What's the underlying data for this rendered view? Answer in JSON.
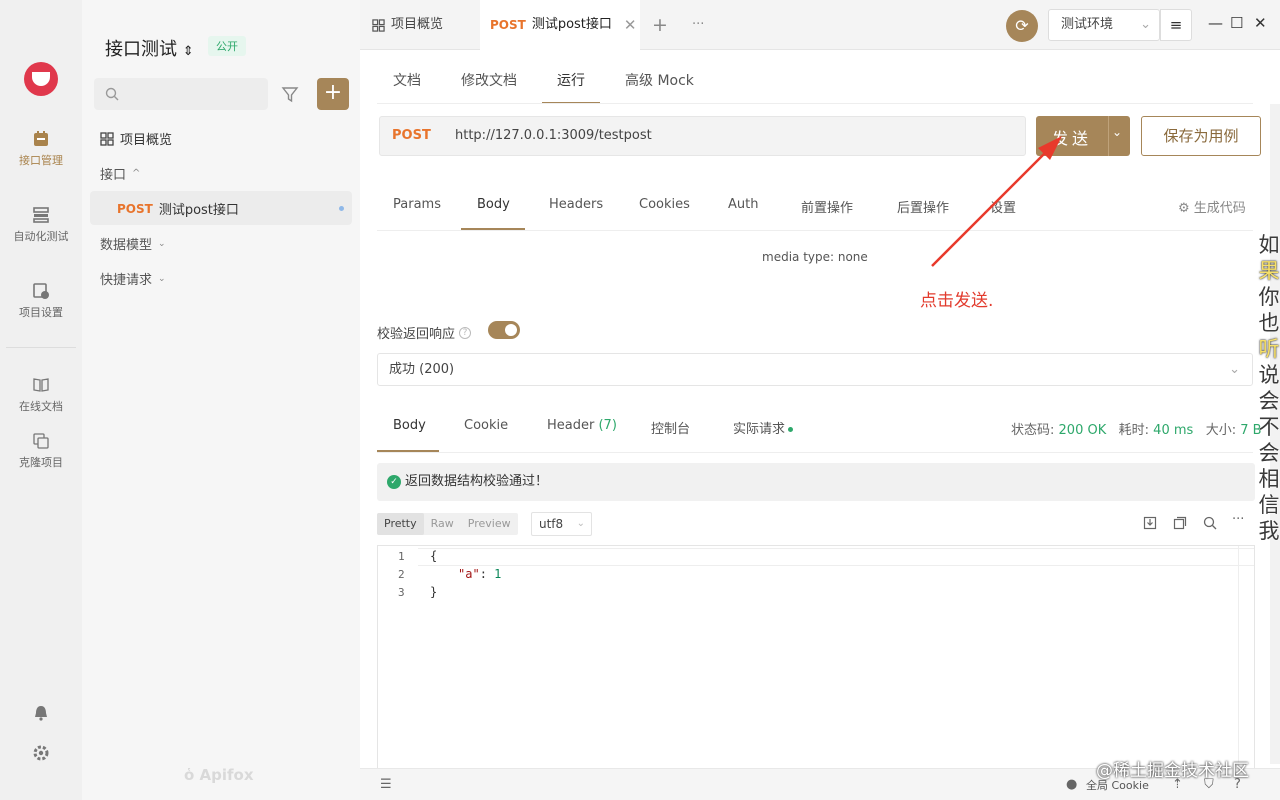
{
  "rail": {
    "items": [
      {
        "label": "接口管理",
        "icon": "api-manage-icon"
      },
      {
        "label": "自动化测试",
        "icon": "auto-test-icon"
      },
      {
        "label": "项目设置",
        "icon": "project-settings-icon"
      },
      {
        "label": "在线文档",
        "icon": "book-icon"
      },
      {
        "label": "克隆项目",
        "icon": "clone-icon"
      }
    ]
  },
  "sidebar": {
    "project_name": "接口测试",
    "project_badge": "公开",
    "overview": "项目概览",
    "api_group": "接口",
    "api_item_method": "POST",
    "api_item_name": "测试post接口",
    "data_model": "数据模型",
    "quick_request": "快捷请求",
    "brand": "Apifox"
  },
  "topbar": {
    "tab_overview": "项目概览",
    "tab_api_method": "POST",
    "tab_api_name": "测试post接口",
    "add_tab": "+",
    "more_tabs": "···",
    "environment": "测试环境"
  },
  "subtabs": [
    "文档",
    "修改文档",
    "运行",
    "高级 Mock"
  ],
  "request": {
    "method": "POST",
    "url": "http://127.0.0.1:3009/testpost",
    "send_label": "发送",
    "save_label": "保存为用例"
  },
  "param_tabs": [
    "Params",
    "Body",
    "Headers",
    "Cookies",
    "Auth",
    "前置操作",
    "后置操作",
    "设置"
  ],
  "gen_code": "生成代码",
  "media_type": "media type: none",
  "annotation": "点击发送.",
  "validation": {
    "label": "校验返回响应",
    "selected": "成功 (200)"
  },
  "response": {
    "tabs": {
      "body": "Body",
      "cookie": "Cookie",
      "header": "Header",
      "header_count": "(7)",
      "console": "控制台",
      "actual": "实际请求"
    },
    "status_label": "状态码:",
    "status_value": "200 OK",
    "time_label": "耗时:",
    "time_value": "40 ms",
    "size_label": "大小:",
    "size_value": "7 B",
    "success_msg": "返回数据结构校验通过！",
    "formats": [
      "Pretty",
      "Raw",
      "Preview"
    ],
    "encoding": "utf8",
    "code_lines": [
      {
        "n": "1",
        "text": "{"
      },
      {
        "n": "2",
        "key": "\"a\"",
        "sep": ": ",
        "val": "1"
      },
      {
        "n": "3",
        "text": "}"
      }
    ]
  },
  "footer": {
    "cookie": "全局 Cookie"
  },
  "watermark": "@稀土掘金技术社区",
  "vertical_text": [
    "如",
    "果",
    "你",
    "也",
    "听",
    "说",
    "会",
    "不",
    "会",
    "相",
    "信",
    "我"
  ]
}
